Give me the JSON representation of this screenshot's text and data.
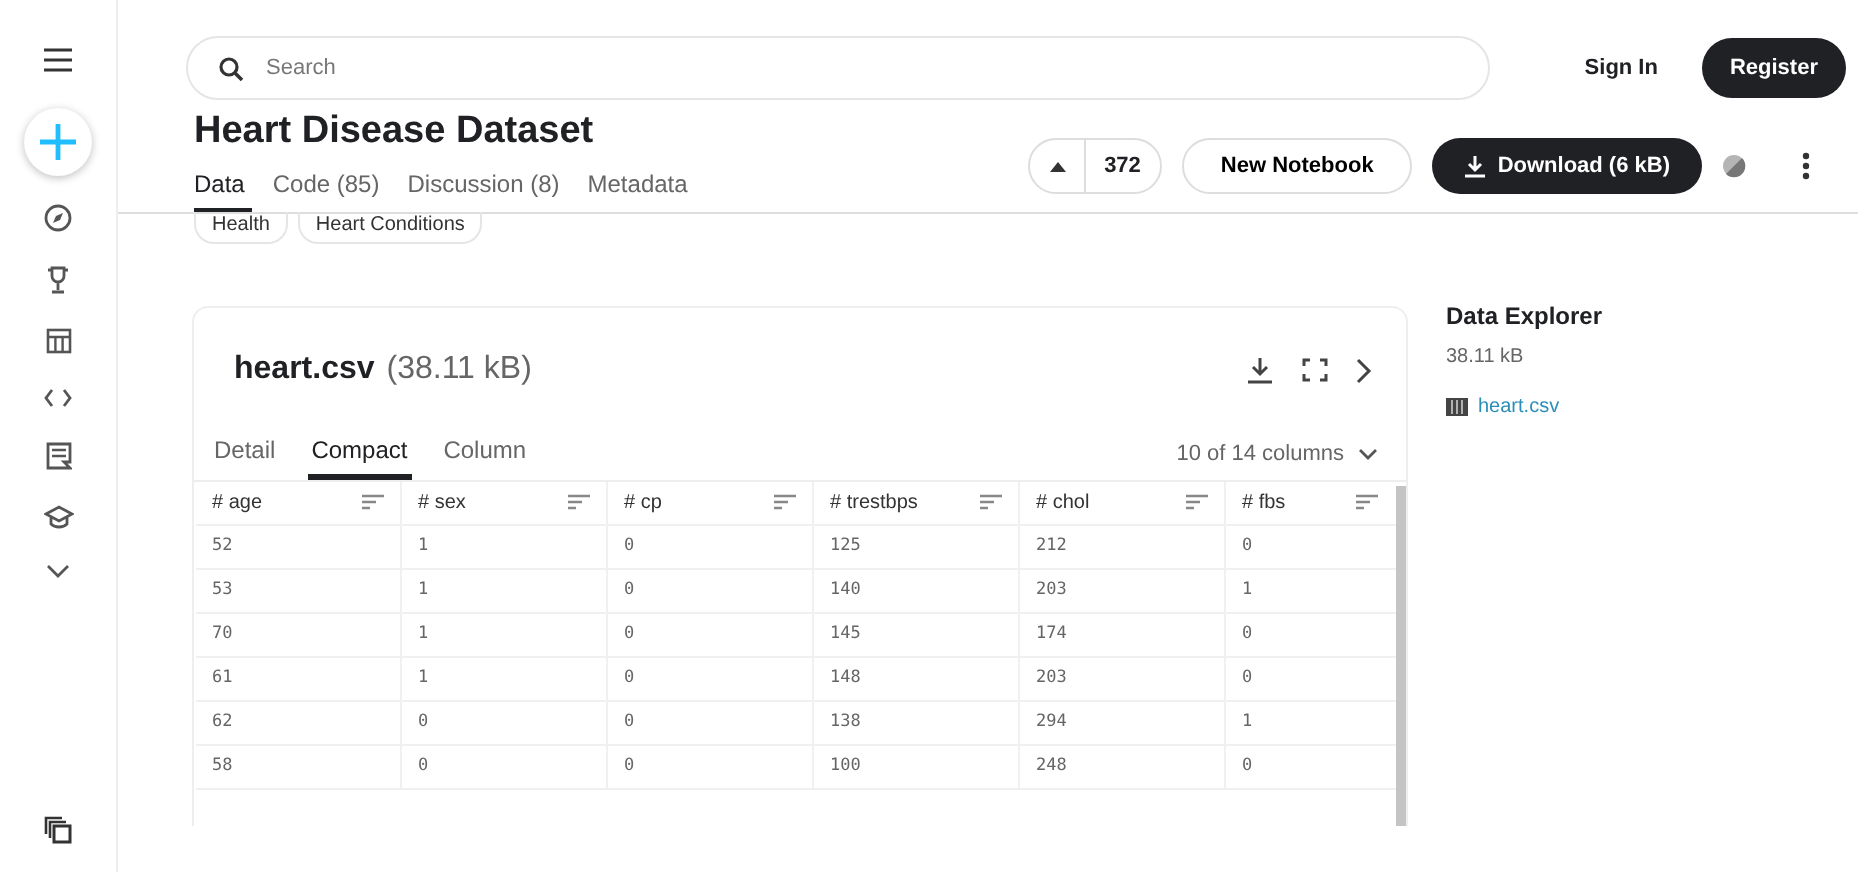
{
  "search": {
    "placeholder": "Search"
  },
  "header_buttons": {
    "sign_in": "Sign In",
    "register": "Register"
  },
  "title": "Heart Disease Dataset",
  "tabs": [
    {
      "label": "Data",
      "selected": true
    },
    {
      "label": "Code (85)",
      "selected": false
    },
    {
      "label": "Discussion (8)",
      "selected": false
    },
    {
      "label": "Metadata",
      "selected": false
    }
  ],
  "upvote": {
    "count": "372"
  },
  "actions": {
    "new_notebook": "New Notebook",
    "download": "Download (6 kB)"
  },
  "tags": [
    "Health",
    "Heart Conditions"
  ],
  "file": {
    "name": "heart.csv",
    "size": "(38.11 kB)"
  },
  "view_tabs": [
    {
      "label": "Detail",
      "selected": false
    },
    {
      "label": "Compact",
      "selected": true
    },
    {
      "label": "Column",
      "selected": false
    }
  ],
  "columns_shown": "10 of 14 columns",
  "table": {
    "columns": [
      "# age",
      "# sex",
      "# cp",
      "# trestbps",
      "# chol",
      "# fbs"
    ],
    "rows": [
      [
        "52",
        "1",
        "0",
        "125",
        "212",
        "0"
      ],
      [
        "53",
        "1",
        "0",
        "140",
        "203",
        "1"
      ],
      [
        "70",
        "1",
        "0",
        "145",
        "174",
        "0"
      ],
      [
        "61",
        "1",
        "0",
        "148",
        "203",
        "0"
      ],
      [
        "62",
        "0",
        "0",
        "138",
        "294",
        "1"
      ],
      [
        "58",
        "0",
        "0",
        "100",
        "248",
        "0"
      ]
    ]
  },
  "data_explorer": {
    "title": "Data Explorer",
    "size": "38.11 kB",
    "files": [
      "heart.csv"
    ]
  }
}
